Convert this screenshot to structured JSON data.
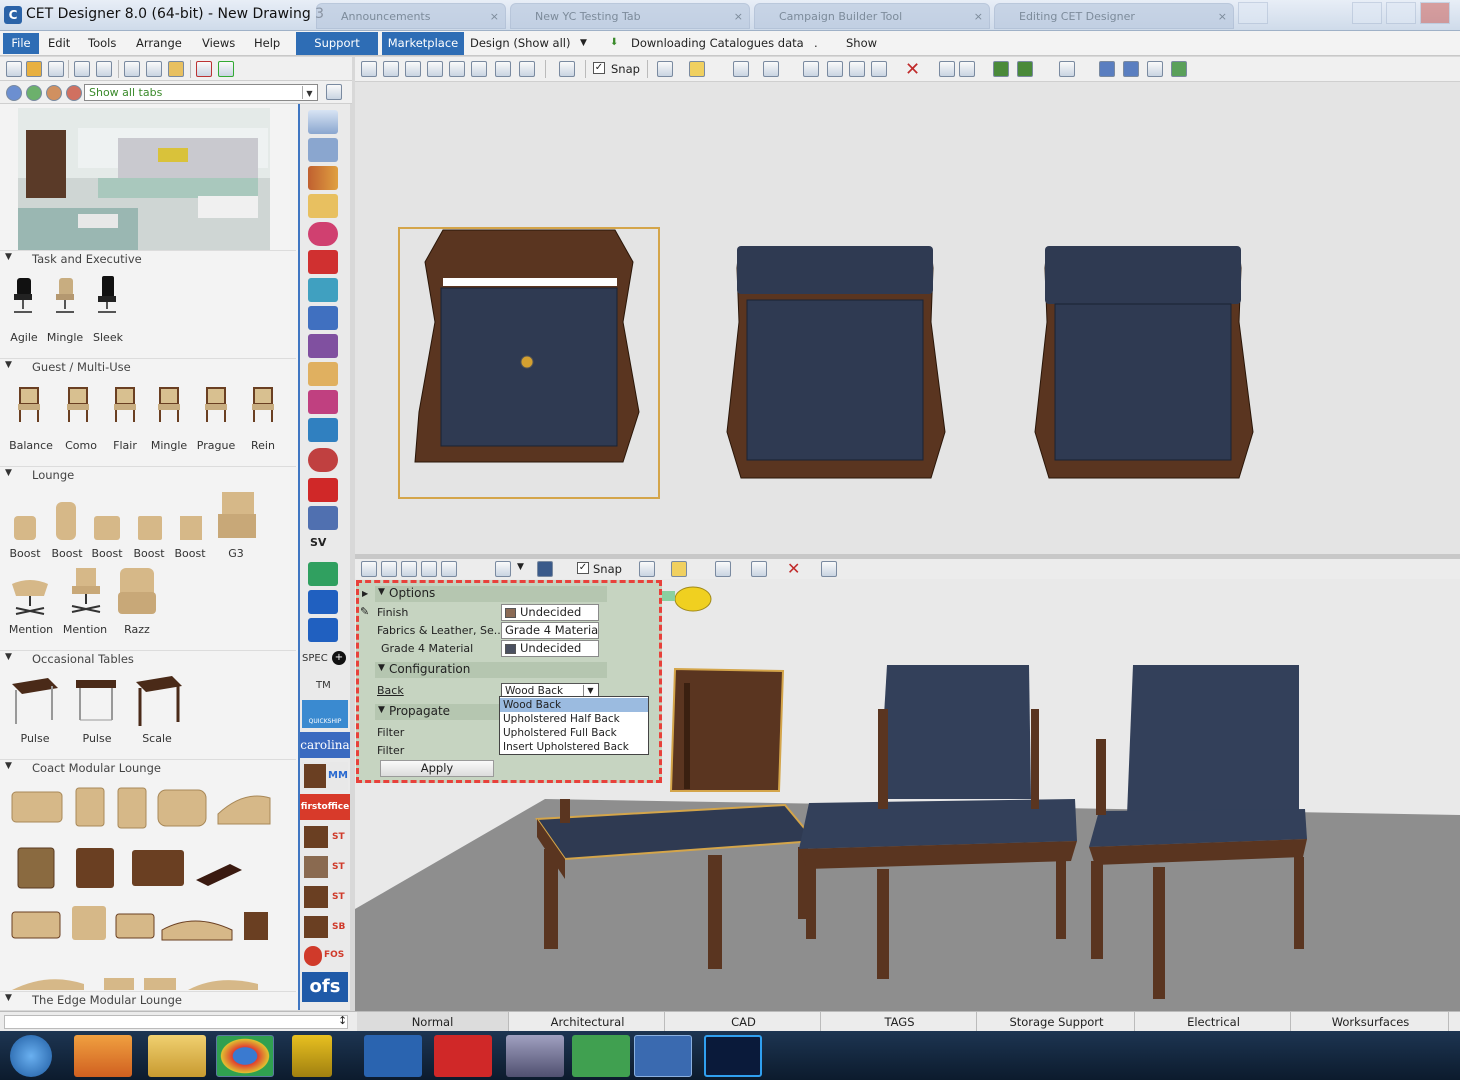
{
  "window": {
    "title": "CET Designer 8.0 (64-bit) - New Drawing 3",
    "background_tabs": [
      "Announcements",
      "New YC Testing Tab",
      "Campaign Builder Tool",
      "Editing CET Designer"
    ]
  },
  "menubar": {
    "items": [
      "File",
      "Edit",
      "Tools",
      "Arrange",
      "Views",
      "Help"
    ],
    "support": "Support",
    "marketplace": "Marketplace",
    "design": "Design (Show all)",
    "status": "Downloading Catalogues data",
    "dot": ".",
    "show": "Show"
  },
  "toolbar": {
    "show_all_tabs": "Show all tabs",
    "snap": "Snap"
  },
  "catalog": {
    "sections": [
      {
        "title": "Task and Executive",
        "items": [
          "Agile",
          "Mingle",
          "Sleek"
        ]
      },
      {
        "title": "Guest / Multi-Use",
        "items": [
          "Balance",
          "Como",
          "Flair",
          "Mingle",
          "Prague",
          "Rein"
        ]
      },
      {
        "title": "Lounge",
        "items": [
          "Boost",
          "Boost",
          "Boost",
          "Boost",
          "Boost",
          "G3",
          "Mention",
          "Mention",
          "Razz"
        ]
      },
      {
        "title": "Occasional Tables",
        "items": [
          "Pulse",
          "Pulse",
          "Scale"
        ]
      },
      {
        "title": "Coact Modular Lounge",
        "items": []
      },
      {
        "title": "The Edge Modular Lounge",
        "items": []
      }
    ]
  },
  "icon_strip": {
    "sv": "SV",
    "spec": "SPEC",
    "tm": "TM",
    "quickship": "QUICKSHIP",
    "carolina": "carolina",
    "mm": "MM",
    "firstoffice": "firstoffice",
    "st": "ST",
    "sb": "SB",
    "fos": "FOS",
    "ofs": "ofs"
  },
  "options_panel": {
    "options_header": "Options",
    "finish_label": "Finish",
    "finish_value": "Undecided",
    "fabrics_label": "Fabrics & Leather, Se...",
    "fabrics_value": "Grade 4 Materia",
    "grade_label": "Grade 4 Material",
    "grade_value": "Undecided",
    "configuration_header": "Configuration",
    "back_label": "Back",
    "back_value": "Wood Back",
    "propagate_header": "Propagate",
    "filter1": "Filter",
    "filter2": "Filter",
    "apply": "Apply",
    "back_options": [
      "Wood Back",
      "Upholstered Half Back",
      "Upholstered Full Back",
      "Insert Upholstered Back"
    ],
    "colors": {
      "finish_swatch": "#8a6a55",
      "grade_swatch": "#4a5060"
    }
  },
  "bottom_tabs": [
    "Normal",
    "Architectural",
    "CAD",
    "TAGS",
    "Storage Support",
    "Electrical",
    "Worksurfaces"
  ],
  "colors": {
    "accent": "#2e6db5",
    "wood": "#5a3520",
    "fabric": "#2f3a52",
    "highlight": "#e8413b",
    "selection": "#d4a54a"
  }
}
